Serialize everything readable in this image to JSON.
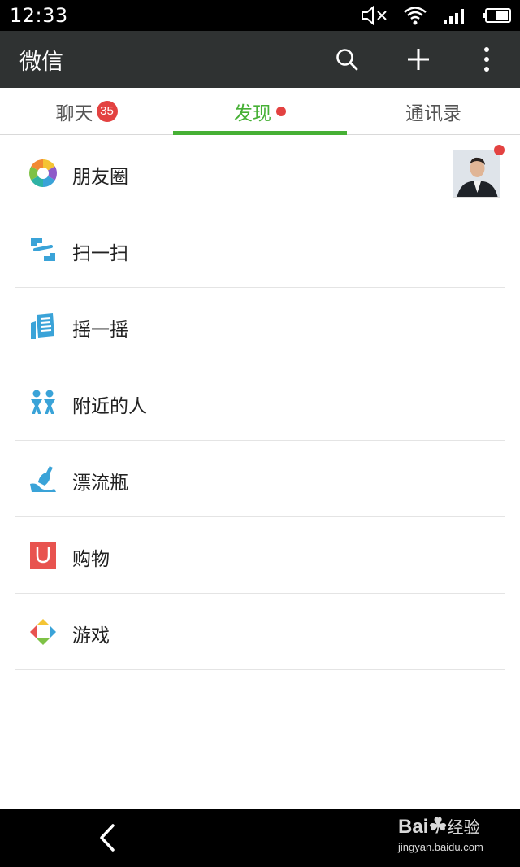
{
  "status_bar": {
    "time": "12:33",
    "icons": [
      "mute-icon",
      "wifi-icon",
      "signal-icon",
      "battery-icon"
    ]
  },
  "app_bar": {
    "title": "微信",
    "actions": [
      "search-icon",
      "plus-icon",
      "more-icon"
    ]
  },
  "tabs": [
    {
      "label": "聊天",
      "badge": "35"
    },
    {
      "label": "发现",
      "dot": true,
      "active": true
    },
    {
      "label": "通讯录"
    }
  ],
  "discover_list": [
    {
      "label": "朋友圈",
      "icon": "moments-icon",
      "has_avatar": true,
      "dot": true
    },
    {
      "label": "扫一扫",
      "icon": "scan-icon"
    },
    {
      "label": "摇一摇",
      "icon": "shake-icon"
    },
    {
      "label": "附近的人",
      "icon": "people-nearby-icon"
    },
    {
      "label": "漂流瓶",
      "icon": "drift-bottle-icon"
    },
    {
      "label": "购物",
      "icon": "shopping-icon"
    },
    {
      "label": "游戏",
      "icon": "games-icon"
    }
  ],
  "bottom_nav": {
    "back": "back-icon"
  },
  "watermark": {
    "logo": "Bai",
    "logo_suffix": "经验",
    "url": "jingyan.baidu.com"
  },
  "colors": {
    "accent": "#46b035",
    "badge": "#e34241",
    "app_bar": "#2f3232",
    "icon_blue": "#3aa3d8",
    "shopping_red": "#e8534f"
  }
}
